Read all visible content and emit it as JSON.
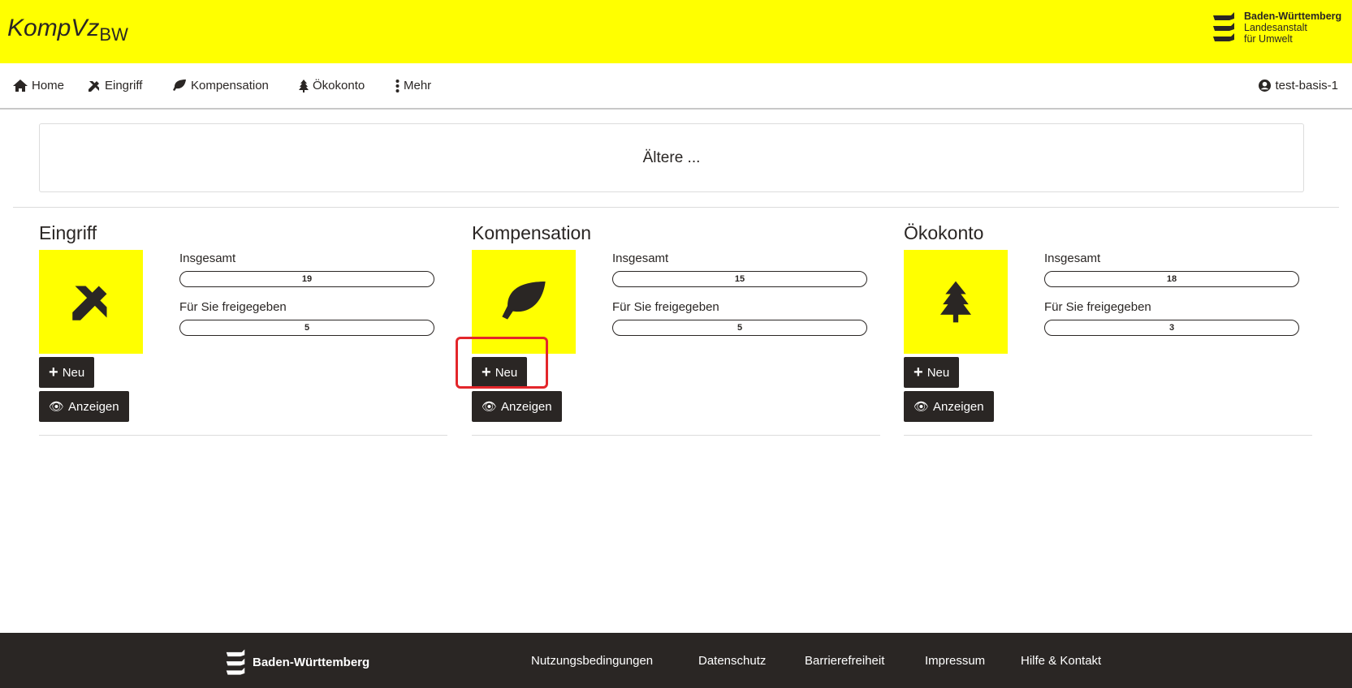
{
  "header": {
    "logo_main": "KompVz",
    "logo_sub": "BW",
    "agency_line1": "Baden-Württemberg",
    "agency_line2": "Landesanstalt",
    "agency_line3": "für Umwelt"
  },
  "nav": {
    "items": [
      {
        "label": "Home",
        "icon": "home-icon"
      },
      {
        "label": "Eingriff",
        "icon": "pencil-ruler-icon"
      },
      {
        "label": "Kompensation",
        "icon": "leaf-icon"
      },
      {
        "label": "Ökokonto",
        "icon": "tree-icon"
      },
      {
        "label": "Mehr",
        "icon": "ellipsis-vertical-icon"
      }
    ],
    "user": "test-basis-1"
  },
  "older_label": "Ältere ...",
  "sections": [
    {
      "title": "Eingriff",
      "total_label": "Insgesamt",
      "total": "19",
      "shared_label": "Für Sie freigegeben",
      "shared": "5",
      "new_label": "Neu",
      "show_label": "Anzeigen"
    },
    {
      "title": "Kompensation",
      "total_label": "Insgesamt",
      "total": "15",
      "shared_label": "Für Sie freigegeben",
      "shared": "5",
      "new_label": "Neu",
      "show_label": "Anzeigen"
    },
    {
      "title": "Ökokonto",
      "total_label": "Insgesamt",
      "total": "18",
      "shared_label": "Für Sie freigegeben",
      "shared": "3",
      "new_label": "Neu",
      "show_label": "Anzeigen"
    }
  ],
  "footer": {
    "brand": "Baden-Württemberg",
    "links": [
      "Nutzungsbedingungen",
      "Datenschutz",
      "Barrierefreiheit",
      "Impressum",
      "Hilfe & Kontakt"
    ]
  },
  "colors": {
    "brand_yellow": "#ffff00",
    "dark": "#2a2624",
    "annotation": "#e3262b"
  }
}
